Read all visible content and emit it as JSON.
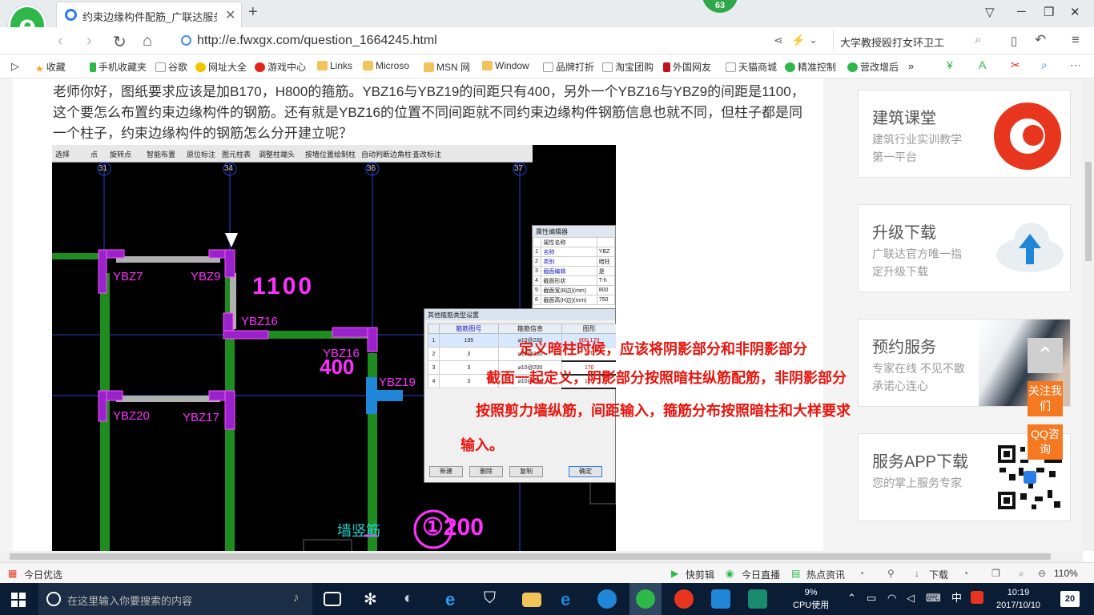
{
  "browser": {
    "tab_title": "约束边缘构件配筋_广联达服务新",
    "new_tab": "+",
    "badge": "63",
    "url": "http://e.fwxgx.com/question_1664245.html",
    "search_text": "大学教授殴打女环卫工"
  },
  "bookmarks": [
    "收藏",
    "手机收藏夹",
    "谷歌",
    "网址大全",
    "游戏中心",
    "Links",
    "Microso",
    "MSN 网",
    "Window",
    "品牌打折",
    "淘宝团购",
    "外国网友",
    "天猫商城",
    "精准控制",
    "营改增后"
  ],
  "bookmarks_more": "»",
  "question": "老师你好，图纸要求应该是加B170，H800的箍筋。YBZ16与YBZ19的间距只有400，另外一个YBZ16与YBZ9的间距是1100，这个要怎么布置约束边缘构件的钢筋。还有就是YBZ16的位置不同间距就不同约束边缘构件钢筋信息也就不同，但柱子都是同一个柱子，约束边缘构件的钢筋怎么分开建立呢？",
  "cad": {
    "toolbar": [
      "选择",
      "点",
      "旋转点",
      "智能布置",
      "原位标注",
      "图元柱表",
      "调整柱端头",
      "按墙位置绘制柱",
      "自动判断边角柱",
      "查改标注"
    ],
    "axes": [
      "31",
      "34",
      "36",
      "37"
    ],
    "labels": [
      "YBZ7",
      "YBZ9",
      "YBZ16",
      "YBZ16",
      "YBZ19",
      "YBZ20",
      "YBZ17"
    ],
    "handwritten": [
      "1100",
      "400",
      "墙竖筋",
      "①200"
    ],
    "prop_title": "属性编辑器",
    "prop_header": "属性名称",
    "props": [
      {
        "no": "1",
        "name": "名称",
        "value": "YBZ"
      },
      {
        "no": "2",
        "name": "类别",
        "value": "暗柱"
      },
      {
        "no": "3",
        "name": "截面编辑",
        "value": "是"
      },
      {
        "no": "4",
        "name": "截面形状",
        "value": "T-h"
      },
      {
        "no": "5",
        "name": "截面宽(B边)(mm)",
        "value": "800"
      },
      {
        "no": "6",
        "name": "截面高(H边)(mm)",
        "value": "750"
      }
    ],
    "dialog_title": "其他箍筋类型设置",
    "dialog_headers": [
      "箍筋图号",
      "箍筋信息",
      "图形"
    ],
    "dialog_rows": [
      {
        "no": "1",
        "code": "195",
        "info": "⌀10@200",
        "shape": "800  170"
      },
      {
        "no": "2",
        "code": "3",
        "info": "⌀10@200",
        "shape": "170"
      },
      {
        "no": "3",
        "code": "3",
        "info": "⌀10@200",
        "shape": "170"
      },
      {
        "no": "4",
        "code": "3",
        "info": "⌀10@200",
        "shape": "170"
      }
    ],
    "dialog_buttons": [
      "新建",
      "删除",
      "复制",
      "确定"
    ]
  },
  "answer_lines": [
    "定义暗柱时候，应该将阴影部分和非阴影部分",
    "截面一起定义，阴影部分按照暗柱纵筋配筋，非阴影部分",
    "按照剪力墙纵筋，间距输入，箍筋分布按照暗柱和大样要求",
    "输入。"
  ],
  "sidebar": [
    {
      "title": "建筑课堂",
      "sub": "建筑行业实训教学第一平台"
    },
    {
      "title": "升级下载",
      "sub": "广联达官方唯一指定升级下载"
    },
    {
      "title": "预约服务",
      "sub": "专家在线 不见不散 承诺心连心"
    },
    {
      "title": "服务APP下载",
      "sub": "您的掌上服务专家"
    }
  ],
  "float_buttons": {
    "follow": "关注我们",
    "qq": "QQ咨询"
  },
  "statusbar": {
    "left": "今日优选",
    "items": [
      "快剪辑",
      "今日直播",
      "热点资讯",
      "下载"
    ],
    "zoom": "110%"
  },
  "taskbar": {
    "search_placeholder": "在这里输入你要搜索的内容",
    "cpu": "9%",
    "cpu_label": "CPU使用",
    "ime": "中",
    "time": "10:19",
    "date": "2017/10/10",
    "notif": "20"
  },
  "colors": {
    "accent_green": "#2fb84a",
    "cad_magenta": "#ff30ff",
    "answer_red": "#e8140c",
    "taskbar_bg": "#0b1d35",
    "float_orange": "#f47920"
  }
}
